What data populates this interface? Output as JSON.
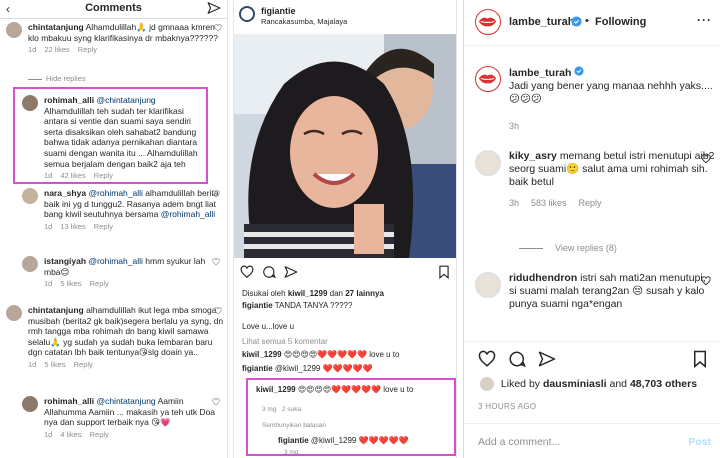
{
  "panel_comments": {
    "title": "Comments",
    "hide_replies": "Hide replies",
    "comments": [
      {
        "user": "chintatanjung",
        "text": "Alhamdulillah🙏 jd gmnaaa kmren klo mbakuu syng klarifikasinya dr mbaknya??????",
        "time": "1d",
        "likes": "22 likes",
        "reply": "Reply"
      },
      {
        "user": "rohimah_alli",
        "mention": "@chintatanjung",
        "text": "Alhamdulillah teh sudah ter klarifikasi antara si ventie dan suami saya sendiri serta disaksikan oleh sahabat2 bandung bahwa tidak adanya pernikahan diantara suami dengan wanita itu ... Alhamdulillah semua berjalam dengan baik2 aja teh",
        "time": "1d",
        "likes": "42 likes",
        "reply": "Reply"
      },
      {
        "user": "nara_shya",
        "mention": "@rohimah_alli",
        "text": "alhamdulillah berita baik ini yg d tunggu2. Rasanya adem bngt liat bang kiwil seutuhnya bersama",
        "mention2": "@rohimah_alli",
        "time": "1d",
        "likes": "13 likes",
        "reply": "Reply"
      },
      {
        "user": "istangiyah",
        "mention": "@rohimah_alli",
        "text": "hmm syukur lah mba😊",
        "time": "1d",
        "likes": "5 likes",
        "reply": "Reply"
      },
      {
        "user": "chintatanjung",
        "text": "alhamdulillah ikut lega mba smoga musibah (berita2 gk baik)segera berlalu ya syng, dn rmh tangga mba rohimah dn bang kiwil samawa selalu🙏 yg sudah ya sudah buka lembaran baru dgn catatan lbh baik tentunya😘slg doain ya..",
        "time": "1d",
        "likes": "5 likes",
        "reply": "Reply"
      },
      {
        "user": "rohimah_alli",
        "mention": "@chintatanjung",
        "text": "Aamiin Allahumma Aamiin ... makasih ya teh utk Doa nya dan support terbaik nya 😘💗",
        "time": "1d",
        "likes": "4 likes",
        "reply": "Reply"
      }
    ]
  },
  "panel_post": {
    "user": "figiantie",
    "location": "Rancakasumba, Majalaya",
    "liked_prefix": "Disukai oleh",
    "liked_user": "kiwil_1299",
    "liked_and": "dan",
    "liked_count": "27 lainnya",
    "caption_user": "figiantie",
    "caption": "TANDA TANYA ?????",
    "caption2": "Love u...love u",
    "view_comments": "Lihat semua 5 komentar",
    "c1_user": "kiwil_1299",
    "c1_text": "😍😍😍😍❤️❤️❤️❤️❤️ love u to",
    "c2_user": "figiantie",
    "c2_text": "@kiwil_1299 ❤️❤️❤️❤️❤️",
    "reply1_user": "kiwil_1299",
    "reply1_text": "😍😍😍😍❤️❤️❤️❤️❤️ love u to",
    "reply1_time": "3 mg",
    "reply1_likes": "2 suka",
    "hide_label": "Sembunyikan balasan",
    "reply2_user": "figiantie",
    "reply2_text": "@kiwil_1299 ❤️❤️❤️❤️❤️",
    "reply2_time": "3 mg"
  },
  "panel_desktop": {
    "user": "lambe_turah",
    "follow_dot": "•",
    "following": "Following",
    "caption_user": "lambe_turah",
    "caption": "Jadi yang bener yang manaa nehhh yaks.... 😕😕😕",
    "caption_time": "3h",
    "comments": [
      {
        "user": "kiky_asry",
        "text": "memang betul istri menutupi aib2 seorg suami🙂 salut ama umi rohimah sih. baik betul",
        "time": "3h",
        "likes": "583 likes",
        "reply": "Reply"
      },
      {
        "user": "ridudhendron",
        "text": "istri sah mati2an menutupi, si suami malah terang2an 😔 susah y kalo punya suami nga*engan"
      }
    ],
    "view_replies": "View replies (8)",
    "liked_by": "Liked by",
    "liked_user": "dausminiasli",
    "liked_and": "and",
    "liked_count": "48,703 others",
    "time_ago": "3 HOURS AGO",
    "add_comment_placeholder": "Add a comment...",
    "post_label": "Post"
  },
  "colors": {
    "highlight": "#d64fcf",
    "link": "#00376b",
    "heart_red": "#ed4956",
    "verified": "#3897f0"
  }
}
